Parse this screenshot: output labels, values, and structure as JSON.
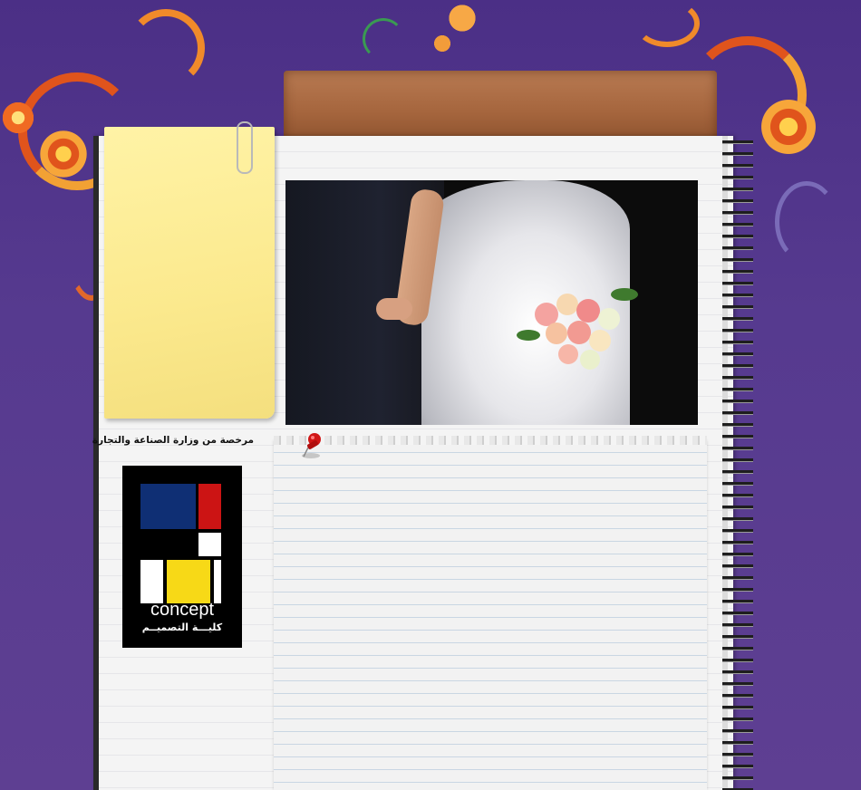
{
  "sidebar": {
    "license_text": "مرخصة من وزارة الصناعة والتجارة"
  },
  "logo": {
    "word": "concept",
    "arabic": "كليـــة التصميــم"
  },
  "colors": {
    "background": "#563a8f",
    "sticky": "#fbe98d",
    "tab": "#a5653d",
    "logo_blue": "#0f2f74",
    "logo_red": "#cc1414",
    "logo_yellow": "#f7d917",
    "pin": "#d01616"
  },
  "icons": [
    "paperclip-icon",
    "pushpin-icon"
  ]
}
